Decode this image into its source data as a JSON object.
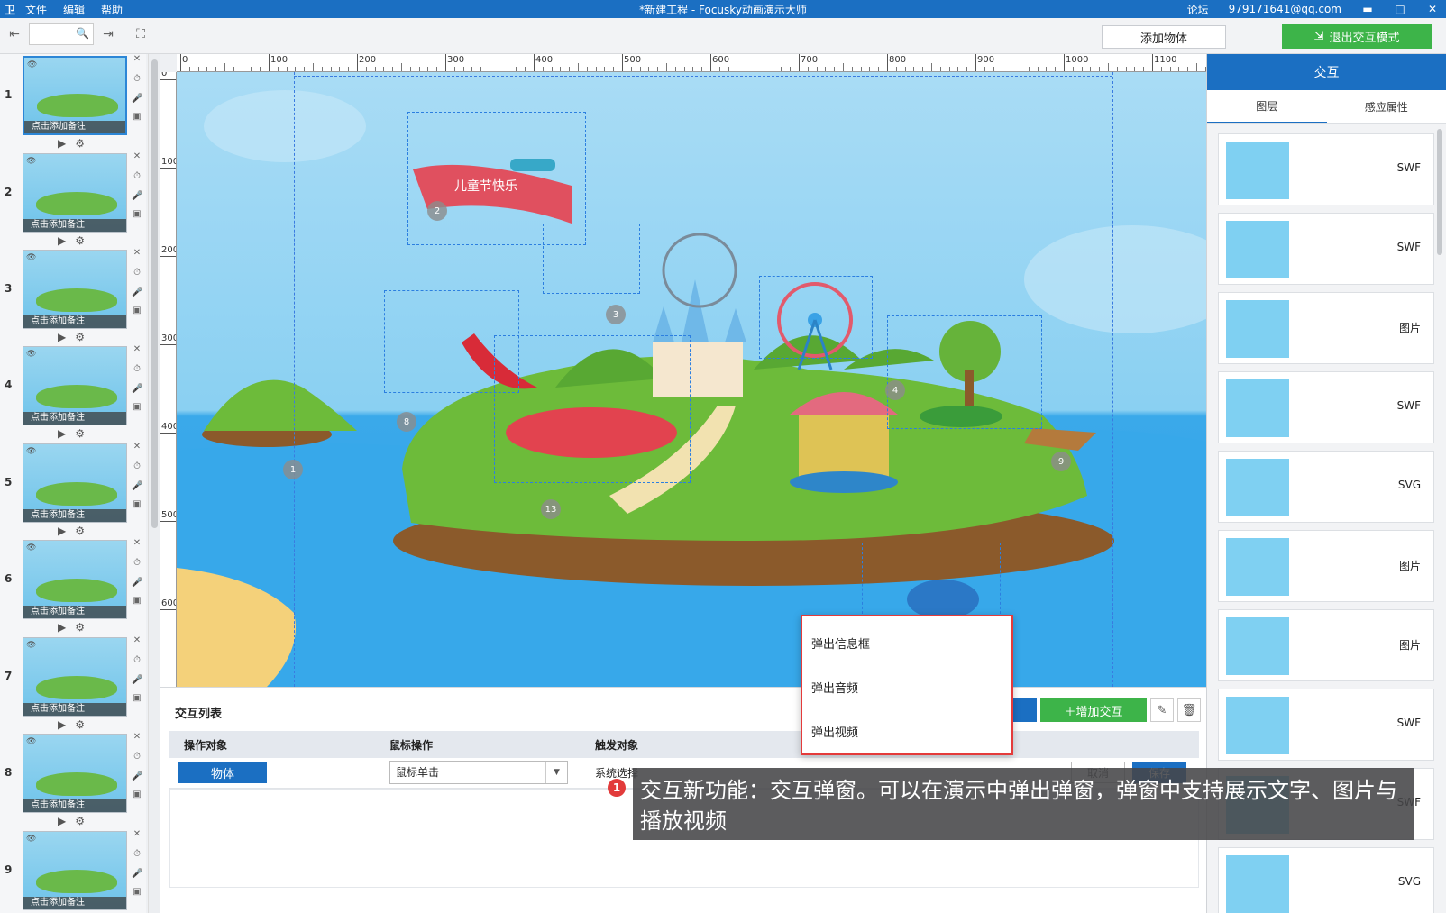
{
  "app": {
    "logo": "卫",
    "title": "*新建工程 - Focusky动画演示大师",
    "menu": [
      "文件",
      "编辑",
      "帮助"
    ],
    "forum": "论坛",
    "account": "979171641@qq.com"
  },
  "toolbar": {
    "add_object": "添加物体",
    "exit_interact": "退出交互模式"
  },
  "slides": {
    "note_label": "点击添加备注",
    "numbers": [
      "1",
      "2",
      "3",
      "4",
      "5",
      "6",
      "7",
      "8",
      "9"
    ],
    "active": 1
  },
  "canvas": {
    "ruler_x": [
      "0",
      "100",
      "200",
      "300",
      "400",
      "500",
      "600",
      "700",
      "800",
      "900",
      "1000",
      "1100"
    ],
    "ruler_y": [
      "0",
      "100",
      "200",
      "300",
      "400",
      "500",
      "600"
    ],
    "banner_text": "儿童节快乐",
    "badges": [
      "1",
      "2",
      "3",
      "4",
      "8",
      "9",
      "13"
    ]
  },
  "right_panel": {
    "header": "交互",
    "tabs": [
      "图层",
      "感应属性"
    ],
    "layers": [
      "SWF",
      "SWF",
      "图片",
      "SWF",
      "SVG",
      "图片",
      "图片",
      "SWF",
      "SWF",
      "SVG"
    ]
  },
  "interaction_list": {
    "title": "交互列表",
    "add_label": "增加交互",
    "headers": [
      "操作对象",
      "鼠标操作",
      "触发对象"
    ],
    "row": {
      "object": "物体",
      "mouse_action": "鼠标单击",
      "trigger": "系统选择",
      "cancel": "取消",
      "save": "保存"
    }
  },
  "popup_menu": {
    "items": [
      "弹出信息框",
      "弹出音频",
      "弹出视频"
    ]
  },
  "caption": {
    "badge": "1",
    "text": "交互新功能：交互弹窗。可以在演示中弹出弹窗，弹窗中支持展示文字、图片与播放视频"
  }
}
